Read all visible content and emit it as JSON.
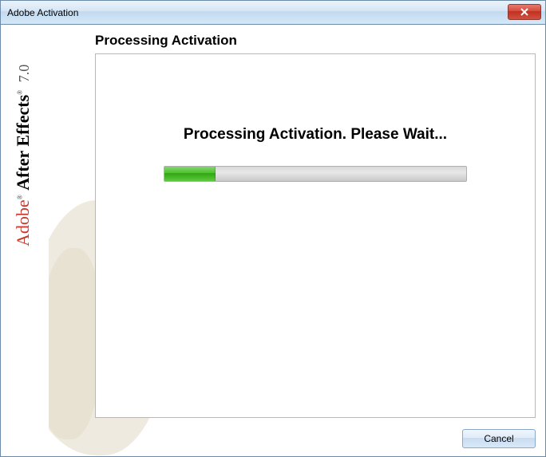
{
  "window": {
    "title": "Adobe Activation"
  },
  "sidebar": {
    "brand": "Adobe",
    "product": "After Effects",
    "version": "7.0"
  },
  "panel": {
    "heading": "Processing Activation",
    "message": "Processing Activation. Please Wait...",
    "progress_percent": 17
  },
  "buttons": {
    "cancel": "Cancel"
  }
}
